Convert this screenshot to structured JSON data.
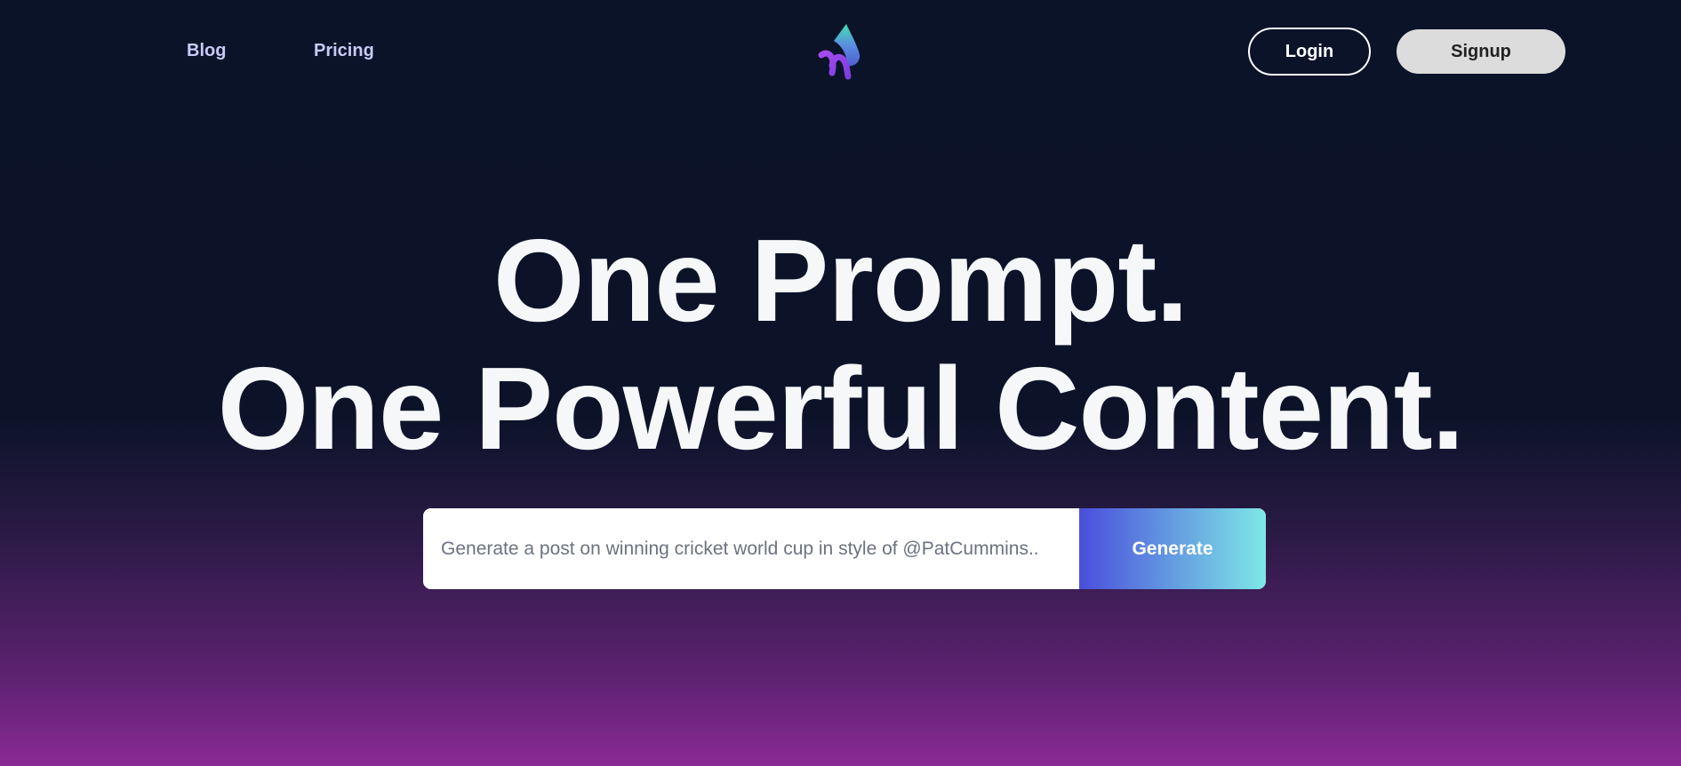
{
  "nav": {
    "blog": "Blog",
    "pricing": "Pricing",
    "login": "Login",
    "signup": "Signup"
  },
  "hero": {
    "line1": "One Prompt.",
    "line2": "One Powerful Content."
  },
  "prompt": {
    "placeholder": "Generate a post on winning cricket world cup in style of @PatCummins..",
    "value": "",
    "button": "Generate"
  },
  "colors": {
    "background": "#0b1329",
    "accent_start": "#4a4edc",
    "accent_end": "#7ee8e6",
    "bottom_purple": "#8a2a95"
  }
}
